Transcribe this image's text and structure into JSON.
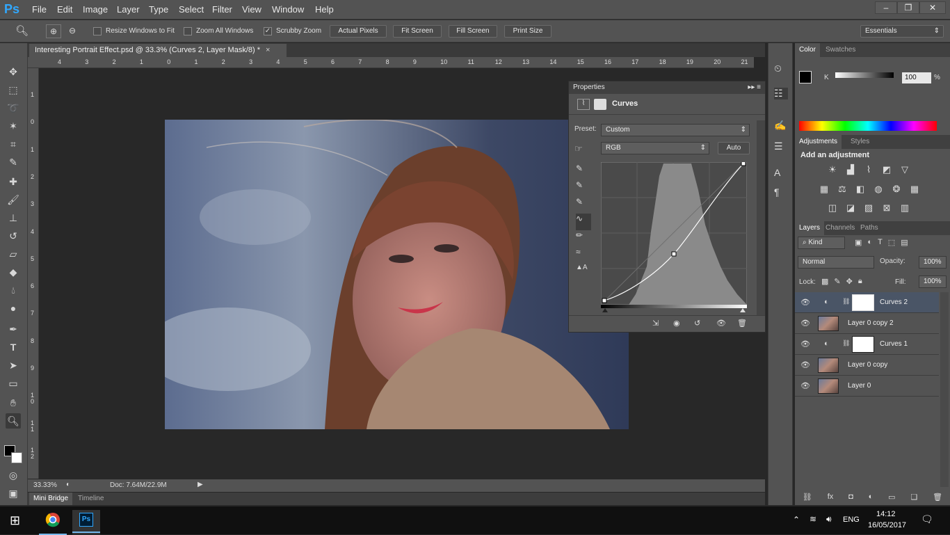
{
  "app": {
    "logo": "Ps",
    "menus": [
      "File",
      "Edit",
      "Image",
      "Layer",
      "Type",
      "Select",
      "Filter",
      "View",
      "Window",
      "Help"
    ],
    "window_controls": [
      "minimize-icon",
      "restore-icon",
      "close-icon"
    ]
  },
  "options": {
    "resize_windows": "Resize Windows to Fit",
    "zoom_all": "Zoom All Windows",
    "scrubby": "Scrubby Zoom",
    "actual_pixels": "Actual Pixels",
    "fit_screen": "Fit Screen",
    "fill_screen": "Fill Screen",
    "print_size": "Print Size",
    "workspace": "Essentials"
  },
  "document": {
    "tab_title": "Interesting Portrait Effect.psd @ 33.3% (Curves 2, Layer Mask/8) *",
    "zoom": "33.33%",
    "doc_size": "Doc: 7.64M/22.9M"
  },
  "ruler": {
    "h": [
      "4",
      "3",
      "2",
      "1",
      "0",
      "1",
      "2",
      "3",
      "4",
      "5",
      "6",
      "7",
      "8",
      "9",
      "10",
      "11",
      "12",
      "13",
      "14",
      "15",
      "16",
      "17",
      "18",
      "19",
      "20",
      "21"
    ],
    "v": [
      "1",
      "0",
      "1",
      "2",
      "3",
      "4",
      "5",
      "6",
      "7",
      "8",
      "9",
      "1\n0",
      "1\n1",
      "1\n2"
    ]
  },
  "bottom_tabs": {
    "mini_bridge": "Mini Bridge",
    "timeline": "Timeline"
  },
  "properties": {
    "title": "Properties",
    "type": "Curves",
    "preset_label": "Preset:",
    "preset_value": "Custom",
    "channel": "RGB",
    "auto": "Auto"
  },
  "color": {
    "tab_color": "Color",
    "tab_swatches": "Swatches",
    "k_label": "K",
    "k_value": "100",
    "pct": "%"
  },
  "adjustments": {
    "tab_adjustments": "Adjustments",
    "tab_styles": "Styles",
    "heading": "Add an adjustment"
  },
  "layers_panel": {
    "tab_layers": "Layers",
    "tab_channels": "Channels",
    "tab_paths": "Paths",
    "kind": "Kind",
    "blend": "Normal",
    "opacity_label": "Opacity:",
    "opacity": "100%",
    "lock_label": "Lock:",
    "fill_label": "Fill:",
    "fill": "100%",
    "layers": [
      {
        "name": "Curves 2",
        "kind": "adjustment",
        "active": true
      },
      {
        "name": "Layer 0 copy 2",
        "kind": "image",
        "active": false
      },
      {
        "name": "Curves 1",
        "kind": "adjustment",
        "active": false
      },
      {
        "name": "Layer 0 copy",
        "kind": "image",
        "active": false
      },
      {
        "name": "Layer 0",
        "kind": "image",
        "active": false
      }
    ]
  },
  "taskbar": {
    "lang": "ENG",
    "time": "14:12",
    "date": "16/05/2017",
    "apps": [
      "chrome-icon",
      "photoshop-icon"
    ]
  },
  "colors": {
    "accent": "#31a8ff",
    "panel": "#535353",
    "dark": "#282828"
  }
}
